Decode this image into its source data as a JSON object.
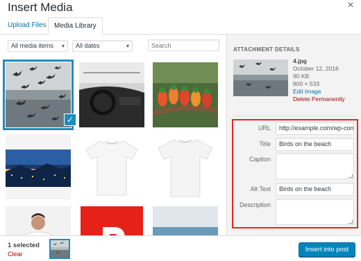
{
  "modal": {
    "title": "Insert Media",
    "close_symbol": "×"
  },
  "tabs": {
    "upload": "Upload Files",
    "library": "Media Library",
    "active": "library"
  },
  "filters": {
    "media_type": "All media items",
    "dates": "All dates",
    "search_placeholder": "Search"
  },
  "grid": {
    "items": [
      {
        "name": "birds-on-beach",
        "selected": true
      },
      {
        "name": "car-interior",
        "selected": false
      },
      {
        "name": "parrots",
        "selected": false
      },
      {
        "name": "city-night-bridge",
        "selected": false
      },
      {
        "name": "white-tshirt",
        "selected": false
      },
      {
        "name": "white-tshirt-2",
        "selected": false
      },
      {
        "name": "man-tshirt",
        "selected": false
      },
      {
        "name": "red-logo",
        "selected": false
      },
      {
        "name": "sea-shore",
        "selected": false
      }
    ]
  },
  "details": {
    "heading": "ATTACHMENT DETAILS",
    "filename": "4.jpg",
    "date": "October 12, 2016",
    "size": "90 KB",
    "dimensions": "800 × 533",
    "edit_link": "Edit Image",
    "delete_link": "Delete Permanently"
  },
  "settings": {
    "url_label": "URL",
    "url_value": "http://example.com/wp-con",
    "title_label": "Title",
    "title_value": "Birds on the beach",
    "caption_label": "Caption",
    "caption_value": "",
    "alt_label": "Alt Text",
    "alt_value": "Birds on the beach",
    "description_label": "Description",
    "description_value": "",
    "highlight_color": "#e22222"
  },
  "footer": {
    "selected_count": "1 selected",
    "clear_label": "Clear",
    "insert_button": "Insert into post"
  },
  "colors": {
    "link": "#0073aa",
    "danger": "#a00000",
    "primary_button": "#0085ba",
    "selection": "#1e8cbe"
  }
}
